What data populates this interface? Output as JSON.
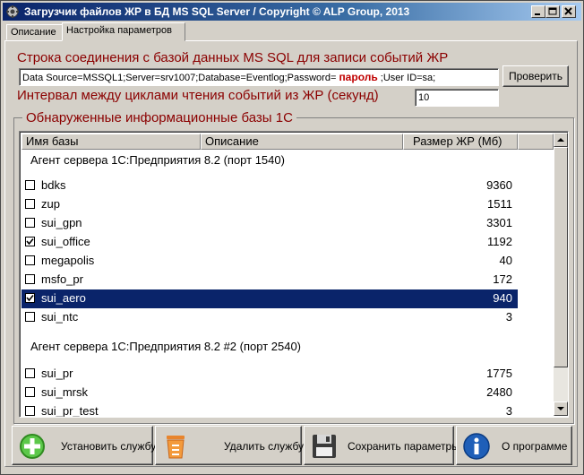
{
  "window": {
    "title": "Загрузчик файлов ЖР в БД MS SQL Server / Copyright © ALP Group, 2013"
  },
  "tabs": [
    {
      "label": "Описание"
    },
    {
      "label": "Настройка параметров"
    }
  ],
  "settings": {
    "conn_label": "Строка соединения с базой данных MS SQL для записи событий ЖР",
    "conn_prefix": "Data Source=MSSQL1;Server=srv1007;Database=Eventlog;Password=",
    "conn_password": "пароль",
    "conn_suffix": ";User ID=sa;",
    "check_button": "Проверить",
    "interval_label": "Интервал между циклами чтения событий из ЖР (секунд)",
    "interval_value": "10"
  },
  "bases": {
    "group_title": "Обнаруженные информационные базы 1С",
    "columns": [
      "Имя базы",
      "Описание",
      "Размер ЖР (Мб)"
    ],
    "groups": [
      {
        "header": "Агент сервера 1С:Предприятия 8.2 (порт 1540)",
        "rows": [
          {
            "name": "bdks",
            "size": "9360",
            "checked": false,
            "selected": false
          },
          {
            "name": "zup",
            "size": "1511",
            "checked": false,
            "selected": false
          },
          {
            "name": "sui_gpn",
            "size": "3301",
            "checked": false,
            "selected": false
          },
          {
            "name": "sui_office",
            "size": "1192",
            "checked": true,
            "selected": false
          },
          {
            "name": "megapolis",
            "size": "40",
            "checked": false,
            "selected": false
          },
          {
            "name": "msfo_pr",
            "size": "172",
            "checked": false,
            "selected": false
          },
          {
            "name": "sui_aero",
            "size": "940",
            "checked": true,
            "selected": true
          },
          {
            "name": "sui_ntc",
            "size": "3",
            "checked": false,
            "selected": false
          }
        ]
      },
      {
        "header": "Агент сервера 1С:Предприятия 8.2 #2 (порт 2540)",
        "rows": [
          {
            "name": "sui_pr",
            "size": "1775",
            "checked": false,
            "selected": false
          },
          {
            "name": "sui_mrsk",
            "size": "2480",
            "checked": false,
            "selected": false
          },
          {
            "name": "sui_pr_test",
            "size": "3",
            "checked": false,
            "selected": false
          }
        ]
      }
    ]
  },
  "actions": {
    "install": "Установить службу",
    "remove": "Удалить службу",
    "save": "Сохранить параметры",
    "about": "О программе"
  },
  "colors": {
    "accent_label": "#8b0000",
    "selection": "#0a246a",
    "password": "#c00000"
  }
}
